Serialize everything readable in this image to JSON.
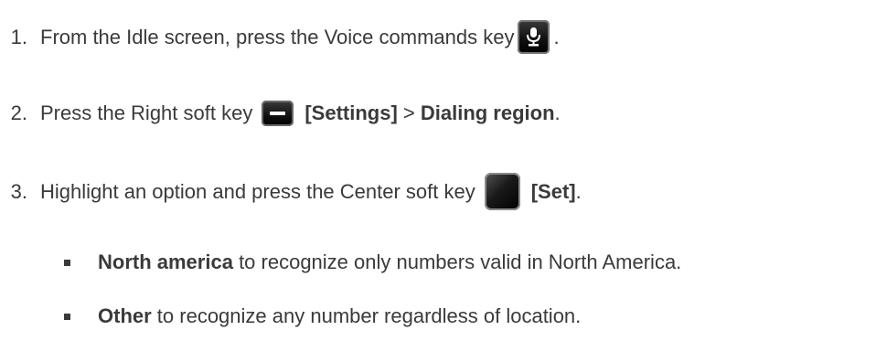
{
  "steps": [
    {
      "number": "1.",
      "text_before": "From the Idle screen, press the Voice commands key",
      "text_after": ".",
      "icon": "voice-commands-key-icon"
    },
    {
      "number": "2.",
      "text_before": "Press the Right soft key",
      "bold_1": "[Settings]",
      "text_mid": " > ",
      "bold_2": "Dialing region",
      "text_after": ".",
      "icon": "right-soft-key-icon"
    },
    {
      "number": "3.",
      "text_before": "Highlight an option and press the Center soft key",
      "bold_1": "[Set]",
      "text_after": ".",
      "icon": "center-soft-key-icon"
    }
  ],
  "bullets": [
    {
      "bold": "North america",
      "text": " to recognize only numbers valid in North America."
    },
    {
      "bold": "Other",
      "text": " to recognize any number regardless of location."
    }
  ],
  "colors": {
    "text": "#3a3a3a",
    "key": "#000000"
  }
}
